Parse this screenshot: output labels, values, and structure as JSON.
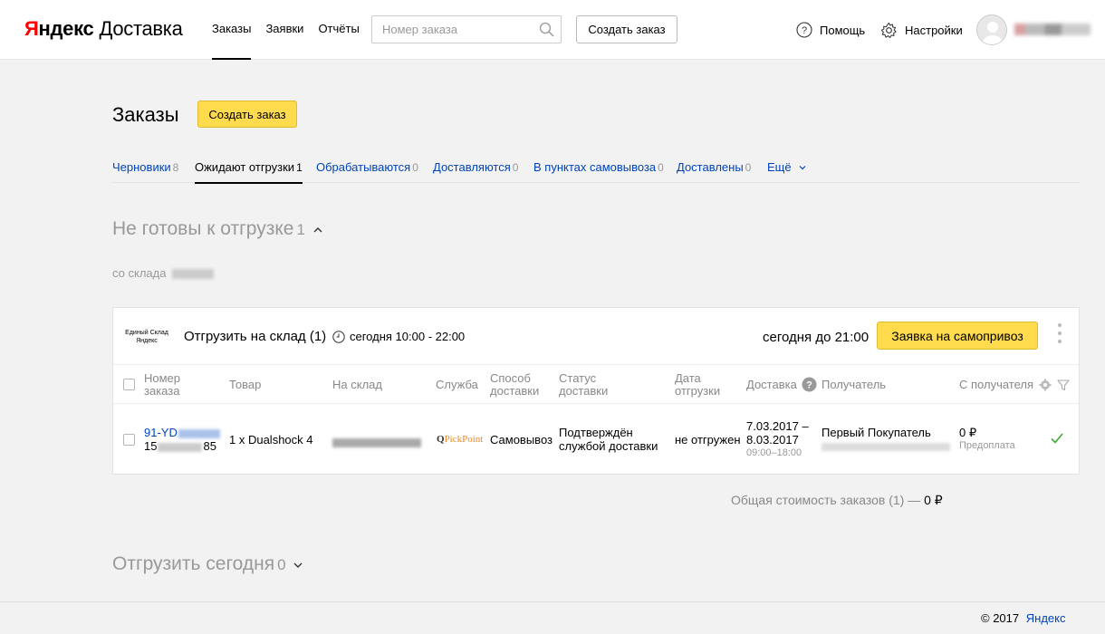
{
  "header": {
    "logo": {
      "brand_first": "Я",
      "brand_rest": "ндекс",
      "product": "Доставка"
    },
    "nav": [
      {
        "label": "Заказы",
        "active": true
      },
      {
        "label": "Заявки",
        "active": false
      },
      {
        "label": "Отчёты",
        "active": false
      }
    ],
    "search": {
      "placeholder": "Номер заказа",
      "value": ""
    },
    "create_order_button": "Создать заказ",
    "help": {
      "label": "Помощь",
      "icon": "question-circle-icon"
    },
    "settings": {
      "label": "Настройки",
      "icon": "gear-icon"
    },
    "user": {
      "avatar_icon": "user-avatar-icon"
    }
  },
  "page": {
    "title": "Заказы",
    "create_button": "Создать заказ",
    "tabs": [
      {
        "label": "Черновики",
        "count": "8",
        "active": false
      },
      {
        "label": "Ожидают отгрузки",
        "count": "1",
        "active": true
      },
      {
        "label": "Обрабатываются",
        "count": "0",
        "active": false
      },
      {
        "label": "Доставляются",
        "count": "0",
        "active": false
      },
      {
        "label": "В пунктах самовывоза",
        "count": "0",
        "active": false
      },
      {
        "label": "Доставлены",
        "count": "0",
        "active": false
      },
      {
        "label": "Ещё",
        "count": "",
        "active": false
      }
    ]
  },
  "not_ready": {
    "title": "Не готовы к отгрузке",
    "count": "1",
    "from_warehouse": "со склада",
    "card": {
      "warehouse_logo_line1": "Единый Склад",
      "warehouse_logo_line2": "Яндекс",
      "ship_title": "Отгрузить на склад (1)",
      "ship_time": "сегодня 10:00 - 22:00",
      "deadline": "сегодня до 21:00",
      "pickup_button": "Заявка на самопривоз",
      "columns": {
        "order": [
          "Номер",
          "заказа"
        ],
        "product": "Товар",
        "warehouse": "На склад",
        "service": "Служба",
        "method": [
          "Способ",
          "доставки"
        ],
        "status": [
          "Статус",
          "доставки"
        ],
        "ship_date": [
          "Дата",
          "отгрузки"
        ],
        "delivery": "Доставка",
        "recipient": "Получатель",
        "from_recipient": "С получателя"
      },
      "rows": [
        {
          "order_prefix": "91-YD",
          "order_line2_prefix": "15",
          "order_line2_suffix": "85",
          "product": "1 x Dualshock 4",
          "service_logo": "PickPoint",
          "method": "Самовывоз",
          "status_line1": "Подтверждён",
          "status_line2": "службой доставки",
          "ship_date": "не отгружен",
          "delivery_line1": "7.03.2017 –",
          "delivery_line2": "8.03.2017",
          "delivery_time": "09:00–18:00",
          "recipient": "Первый Покупатель",
          "amount": "0 ₽",
          "payment_type": "Предоплата",
          "check_icon": "checkmark-icon"
        }
      ]
    },
    "total_label": "Общая стоимость заказов (1) —",
    "total_value": "0 ₽"
  },
  "ship_today": {
    "title": "Отгрузить сегодня",
    "count": "0"
  },
  "footer": {
    "copyright": "© 2017",
    "link": "Яндекс"
  },
  "colors": {
    "accent_yellow": "#ffdb4d",
    "link_blue": "#04b",
    "brand_red": "#ff0000",
    "check_green": "#3cab2f"
  }
}
